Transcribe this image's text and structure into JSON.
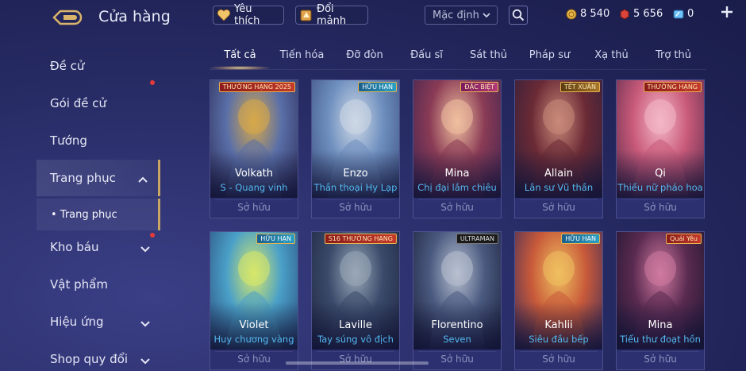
{
  "header": {
    "title": "Cửa hàng",
    "favorites_label": "Yêu thích",
    "exchange_label": "Đổi mảnh",
    "sort_value": "Mặc định",
    "currencies": [
      {
        "name": "gold",
        "value": "8 540",
        "color": "#e9b949"
      },
      {
        "name": "voucher",
        "value": "5 656",
        "color": "#d9443b"
      },
      {
        "name": "coupon",
        "value": "0",
        "color": "#6fc3ff"
      }
    ]
  },
  "sidebar": {
    "items": [
      {
        "label": "Đề cử",
        "has_chevron": false,
        "dot": false
      },
      {
        "label": "Gói đề cử",
        "has_chevron": false,
        "dot": true
      },
      {
        "label": "Tướng",
        "has_chevron": false,
        "dot": false
      },
      {
        "label": "Trang phục",
        "has_chevron": true,
        "dot": false,
        "active": true
      },
      {
        "label": "Kho báu",
        "has_chevron": true,
        "dot": true
      },
      {
        "label": "Vật phẩm",
        "has_chevron": false,
        "dot": false
      },
      {
        "label": "Hiệu ứng",
        "has_chevron": true,
        "dot": false
      },
      {
        "label": "Shop quy đổi",
        "has_chevron": true,
        "dot": false
      }
    ],
    "sub_item": "• Trang phục"
  },
  "tabs": [
    "Tất cả",
    "Tiến hóa",
    "Đỡ đòn",
    "Đấu sĩ",
    "Sát thủ",
    "Pháp sư",
    "Xạ thủ",
    "Trợ thủ"
  ],
  "active_tab": 0,
  "cards": [
    {
      "hero": "Volkath",
      "skin": "S - Quang vinh",
      "status": "Sở hữu",
      "badge": "THƯỜNG HẠNG 2025",
      "badge_style": "red",
      "art": [
        "#d8a94a",
        "#5a6fa8",
        "#2b2a55"
      ]
    },
    {
      "hero": "Enzo",
      "skin": "Thần thoại Hy Lạp",
      "status": "Sở hữu",
      "badge": "HỮU HẠN",
      "badge_style": "blue",
      "art": [
        "#cfd9e6",
        "#6e8fbf",
        "#3a4d7d"
      ]
    },
    {
      "hero": "Mina",
      "skin": "Chị đại lắm chiêu",
      "status": "Sở hữu",
      "badge": "ĐẶC BIỆT",
      "badge_style": "red2",
      "art": [
        "#f0c0a0",
        "#8a3b55",
        "#3b2250"
      ]
    },
    {
      "hero": "Allain",
      "skin": "Lân sư Vũ thần",
      "status": "Sở hữu",
      "badge": "TẾT XUÂN",
      "badge_style": "gold",
      "art": [
        "#c98a7a",
        "#6a2a35",
        "#2c1e3d"
      ]
    },
    {
      "hero": "Qi",
      "skin": "Thiếu nữ pháo hoa",
      "status": "Sở hữu",
      "badge": "THƯỜNG HẠNG",
      "badge_style": "red",
      "art": [
        "#f4b8c8",
        "#c95a7a",
        "#5a2a4a"
      ]
    },
    {
      "hero": "Violet",
      "skin": "Huy chương vàng",
      "status": "Sở hữu",
      "badge": "HỮU HẠN",
      "badge_style": "blue",
      "art": [
        "#d8e86a",
        "#4aa0c8",
        "#2a4a7a"
      ]
    },
    {
      "hero": "Laville",
      "skin": "Tay súng vô địch",
      "status": "Sở hữu",
      "badge": "S16 THƯỜNG HẠNG",
      "badge_style": "red",
      "art": [
        "#9aa8b8",
        "#3a4a6a",
        "#1e2540"
      ]
    },
    {
      "hero": "Florentino",
      "skin": "Seven",
      "status": "Sở hữu",
      "badge": "ULTRAMAN",
      "badge_style": "dark",
      "art": [
        "#b8c0d0",
        "#4a5a80",
        "#1a1e38"
      ]
    },
    {
      "hero": "Kahlii",
      "skin": "Siêu đầu bếp",
      "status": "Sở hữu",
      "badge": "HỮU HẠN",
      "badge_style": "blue",
      "art": [
        "#f0c060",
        "#c85a3a",
        "#3a2a5a"
      ]
    },
    {
      "hero": "Mina",
      "skin": "Tiểu thư đoạt hồn",
      "status": "Sở hữu",
      "badge": "Quái Yêu",
      "badge_style": "red",
      "art": [
        "#d07aa0",
        "#5a2a50",
        "#1a1530"
      ]
    }
  ]
}
